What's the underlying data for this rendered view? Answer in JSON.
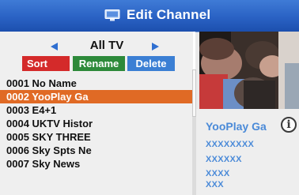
{
  "header": {
    "title": "Edit Channel",
    "icon": "tv-icon"
  },
  "group": {
    "label": "All TV"
  },
  "buttons": {
    "sort": "Sort",
    "rename": "Rename",
    "delete": "Delete"
  },
  "channels": [
    {
      "label": "0001 No Name"
    },
    {
      "label": "0002 YooPlay Ga",
      "selected": true
    },
    {
      "label": "0003 E4+1"
    },
    {
      "label": "0004 UKTV Histor"
    },
    {
      "label": "0005 SKY THREE"
    },
    {
      "label": "0006 Sky Spts Ne"
    },
    {
      "label": "0007 Sky News"
    }
  ],
  "info": {
    "channel_name": "YooPlay Ga",
    "icon_glyph": "i",
    "line1": "XXXXXXXX",
    "line2": "XXXXXX",
    "line3": "XXXX",
    "line4": "XXX"
  },
  "colors": {
    "header": "#2a62c4",
    "selected_row": "#e06a25",
    "sort": "#d42a2a",
    "rename": "#2d8a3a",
    "delete": "#3b7fd4",
    "info_text": "#4a8ad8"
  }
}
